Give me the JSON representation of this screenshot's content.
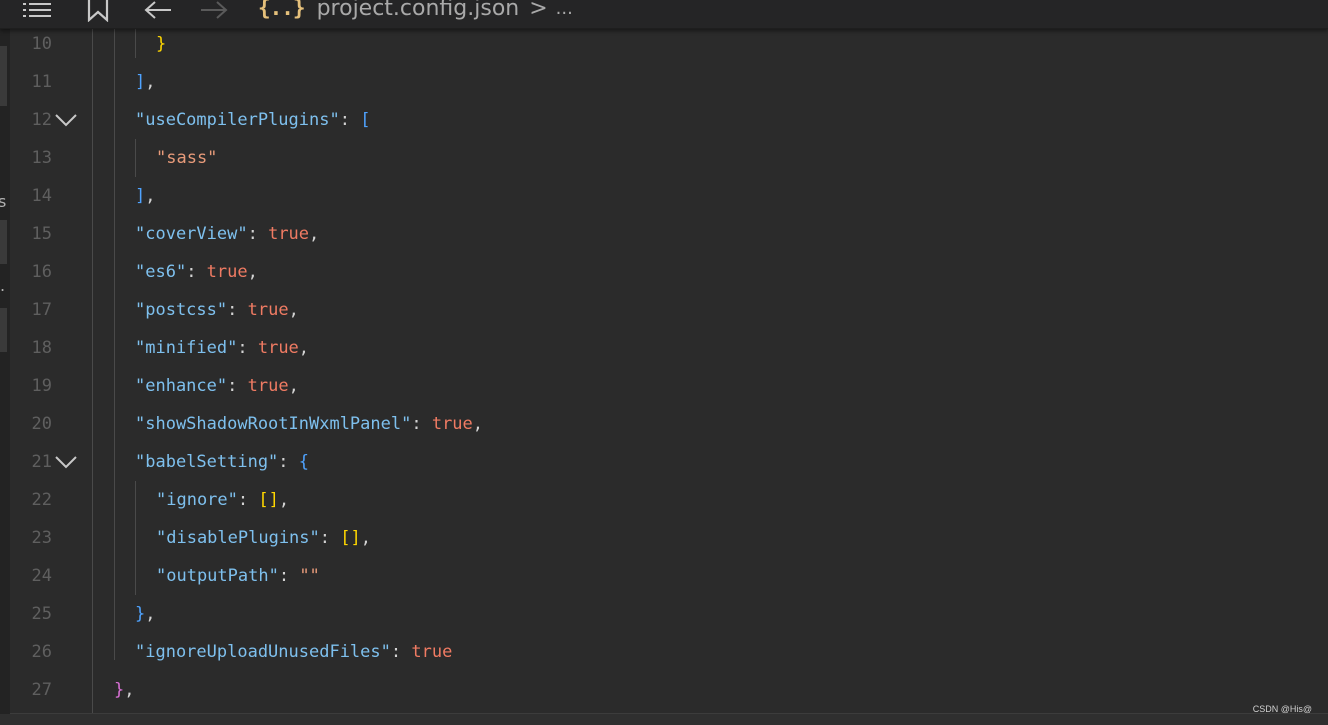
{
  "toolbar": {
    "icons": [
      "menu-icon",
      "bookmark-icon",
      "back-arrow-icon",
      "forward-arrow-icon"
    ],
    "breadcrumb": {
      "file_icon": "{..}",
      "file_name": "project.config.json",
      "separator": ">",
      "more": "..."
    }
  },
  "sidebar_fragments": {
    "char_s": "s",
    "char_dot": "."
  },
  "editor": {
    "line_numbers": [
      "10",
      "11",
      "12",
      "13",
      "14",
      "15",
      "16",
      "17",
      "18",
      "19",
      "20",
      "21",
      "22",
      "23",
      "24",
      "25",
      "26",
      "27"
    ],
    "folded_lines": [
      "12",
      "21"
    ],
    "lines": [
      {
        "num": "10",
        "text": "}"
      },
      {
        "num": "11",
        "text": "],"
      },
      {
        "num": "12",
        "text": "\"useCompilerPlugins\": ["
      },
      {
        "num": "13",
        "text": "\"sass\""
      },
      {
        "num": "14",
        "text": "],"
      },
      {
        "num": "15",
        "text": "\"coverView\": true,"
      },
      {
        "num": "16",
        "text": "\"es6\": true,"
      },
      {
        "num": "17",
        "text": "\"postcss\": true,"
      },
      {
        "num": "18",
        "text": "\"minified\": true,"
      },
      {
        "num": "19",
        "text": "\"enhance\": true,"
      },
      {
        "num": "20",
        "text": "\"showShadowRootInWxmlPanel\": true,"
      },
      {
        "num": "21",
        "text": "\"babelSetting\": {"
      },
      {
        "num": "22",
        "text": "\"ignore\": [],"
      },
      {
        "num": "23",
        "text": "\"disablePlugins\": [],"
      },
      {
        "num": "24",
        "text": "\"outputPath\": \"\""
      },
      {
        "num": "25",
        "text": "},"
      },
      {
        "num": "26",
        "text": "\"ignoreUploadUnusedFiles\": true"
      },
      {
        "num": "27",
        "text": "},"
      }
    ],
    "tokens": {
      "l10_brace": "}",
      "l11_bracket": "]",
      "comma": ",",
      "colon": ": ",
      "l12_key": "\"useCompilerPlugins\"",
      "l12_open": "[",
      "l13_str": "\"sass\"",
      "l14_bracket": "]",
      "l15_key": "\"coverView\"",
      "l16_key": "\"es6\"",
      "l17_key": "\"postcss\"",
      "l18_key": "\"minified\"",
      "l19_key": "\"enhance\"",
      "l20_key": "\"showShadowRootInWxmlPanel\"",
      "l21_key": "\"babelSetting\"",
      "l21_open": "{",
      "l22_key": "\"ignore\"",
      "l23_key": "\"disablePlugins\"",
      "empty_array": "[]",
      "l24_key": "\"outputPath\"",
      "l24_val": "\"\"",
      "l25_brace": "}",
      "l26_key": "\"ignoreUploadUnusedFiles\"",
      "l27_brace": "}",
      "true_val": "true"
    },
    "colors": {
      "background": "#2b2b2b",
      "key": "#7ec0ee",
      "string": "#e89b7a",
      "boolean": "#f07b63",
      "bracket_yellow": "#ffd700",
      "bracket_blue": "#4fa3ff",
      "bracket_magenta": "#da70d6",
      "line_number": "#5f5f5f"
    }
  },
  "watermark": "CSDN @His@"
}
